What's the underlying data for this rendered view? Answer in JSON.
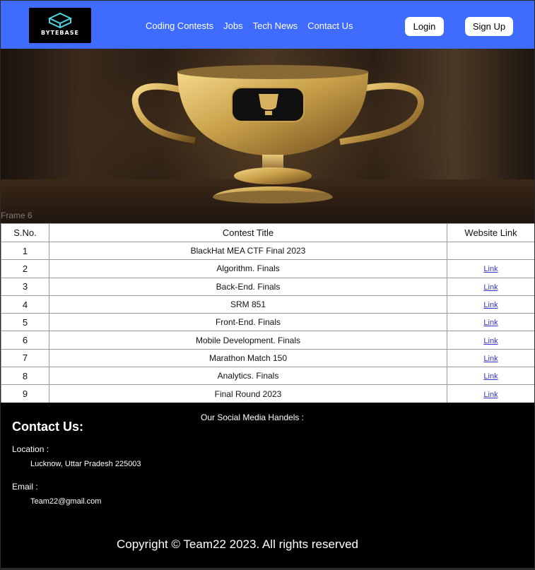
{
  "brand": {
    "logo_text": "BYTEBASE"
  },
  "nav": {
    "links": [
      "Coding Contests",
      "Jobs",
      "Tech News",
      "Contact Us"
    ],
    "login": "Login",
    "signup": "Sign Up"
  },
  "hero": {
    "frame_label": "Frame 6"
  },
  "table": {
    "headers": [
      "S.No.",
      "Contest Title",
      "Website Link"
    ],
    "rows": [
      {
        "sno": "1",
        "title": "BlackHat MEA CTF Final 2023",
        "link": ""
      },
      {
        "sno": "2",
        "title": "Algorithm. Finals",
        "link": "Link"
      },
      {
        "sno": "3",
        "title": "Back-End. Finals",
        "link": "Link"
      },
      {
        "sno": "4",
        "title": "SRM 851",
        "link": "Link"
      },
      {
        "sno": "5",
        "title": "Front-End. Finals",
        "link": "Link"
      },
      {
        "sno": "6",
        "title": "Mobile Development. Finals",
        "link": "Link"
      },
      {
        "sno": "7",
        "title": "Marathon Match 150",
        "link": "Link"
      },
      {
        "sno": "8",
        "title": "Analytics. Finals",
        "link": "Link"
      },
      {
        "sno": "9",
        "title": "Final Round 2023",
        "link": "Link"
      }
    ]
  },
  "footer": {
    "contact_title": "Contact Us:",
    "social_label": "Our Social Media Handels :",
    "location_label": "Location :",
    "location_value": "Lucknow, Uttar Pradesh 225003",
    "email_label": "Email :",
    "email_value": "Team22@gmail.com",
    "copyright": "Copyright © Team22 2023. All rights reserved"
  },
  "colors": {
    "navbar": "#3f6bff",
    "link": "#3333cc",
    "footer": "#000000"
  }
}
